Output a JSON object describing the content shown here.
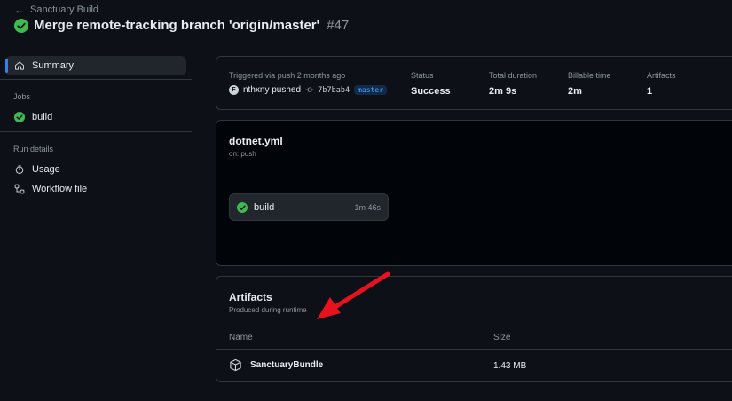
{
  "header": {
    "back_label": "Sanctuary Build",
    "title": "Merge remote-tracking branch 'origin/master'",
    "run_number": "#47"
  },
  "sidebar": {
    "summary_label": "Summary",
    "jobs_section": "Jobs",
    "job_label": "build",
    "run_details_section": "Run details",
    "usage_label": "Usage",
    "workflow_file_label": "Workflow file"
  },
  "summary": {
    "trigger_text": "Triggered via push 2 months ago",
    "actor_initial": "F",
    "actor_pushed": "nthxny pushed",
    "commit_sha": "7b7bab4",
    "branch": "master",
    "status_label": "Status",
    "status_value": "Success",
    "duration_label": "Total duration",
    "duration_value": "2m 9s",
    "billable_label": "Billable time",
    "billable_value": "2m",
    "artifacts_label": "Artifacts",
    "artifacts_value": "1"
  },
  "workflow": {
    "file_name": "dotnet.yml",
    "trigger": "on: push",
    "job_name": "build",
    "job_duration": "1m 46s"
  },
  "artifacts": {
    "title": "Artifacts",
    "subtitle": "Produced during runtime",
    "col_name": "Name",
    "col_size": "Size",
    "items": [
      {
        "name": "SanctuaryBundle",
        "size": "1.43 MB"
      }
    ]
  },
  "colors": {
    "success": "#3fb950",
    "accent": "#2f81f7",
    "annotation_arrow": "#e8121f"
  }
}
